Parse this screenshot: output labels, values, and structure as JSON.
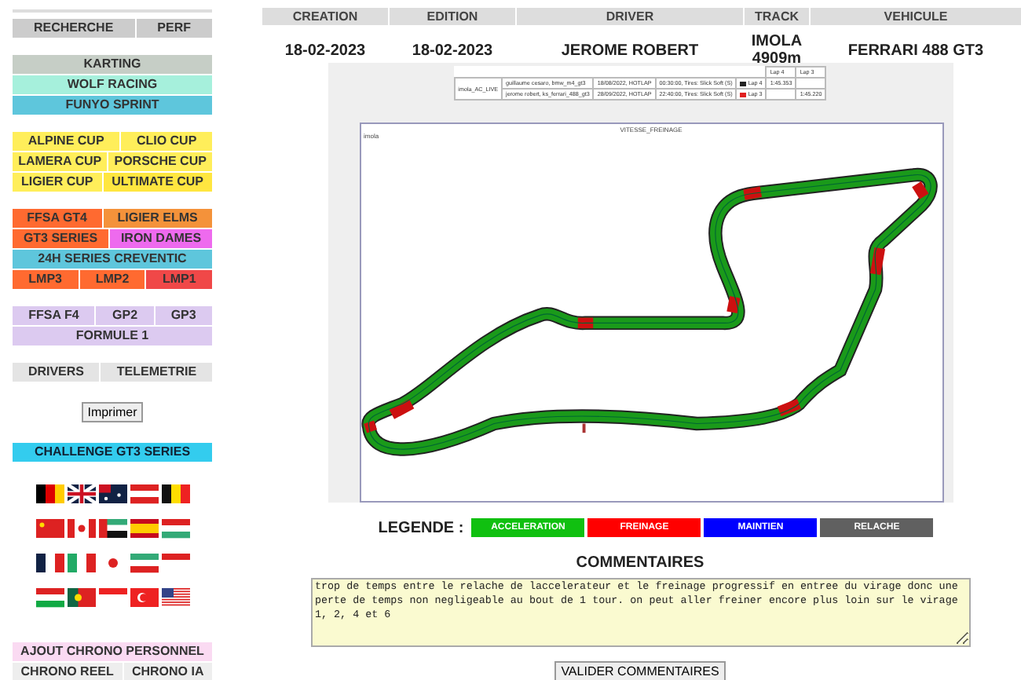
{
  "sidebar": {
    "groups": [
      [
        [
          {
            "label": "RECHERCHE",
            "color": "#cccccc"
          },
          {
            "label": "PERF",
            "color": "#cccccc"
          }
        ]
      ],
      [
        [
          {
            "label": "KARTING",
            "color": "#c6cec6"
          }
        ],
        [
          {
            "label": "WOLF RACING",
            "color": "#a6f0dc"
          }
        ],
        [
          {
            "label": "FUNYO SPRINT",
            "color": "#5ec6dc"
          }
        ]
      ],
      [
        [
          {
            "label": "ALPINE CUP",
            "color": "#ffee5a"
          },
          {
            "label": "CLIO CUP",
            "color": "#ffee5a"
          }
        ],
        [
          {
            "label": "LAMERA CUP",
            "color": "#ffee5a"
          },
          {
            "label": "PORSCHE CUP",
            "color": "#ffee5a"
          }
        ],
        [
          {
            "label": "LIGIER CUP",
            "color": "#ffee5a"
          },
          {
            "label": "ULTIMATE CUP",
            "color": "#ffe640"
          }
        ]
      ],
      [
        [
          {
            "label": "FFSA GT4",
            "color": "#ff6a30"
          },
          {
            "label": "LIGIER ELMS",
            "color": "#f4923a"
          }
        ],
        [
          {
            "label": "GT3 SERIES",
            "color": "#ff6a30"
          },
          {
            "label": "IRON DAMES",
            "color": "#ee6aee"
          }
        ],
        [
          {
            "label": "24H SERIES CREVENTIC",
            "color": "#5ec6dc"
          }
        ],
        [
          {
            "label": "LMP3",
            "color": "#ff6a30"
          },
          {
            "label": "LMP2",
            "color": "#ff6a30"
          },
          {
            "label": "LMP1",
            "color": "#f04848"
          }
        ]
      ],
      [
        [
          {
            "label": "FFSA F4",
            "color": "#dccaf0"
          },
          {
            "label": "GP2",
            "color": "#dccaf0"
          },
          {
            "label": "GP3",
            "color": "#dccaf0"
          }
        ],
        [
          {
            "label": "FORMULE 1",
            "color": "#dccaf0"
          }
        ]
      ],
      [
        [
          {
            "label": "DRIVERS",
            "color": "#e4e4e4"
          },
          {
            "label": "TELEMETRIE",
            "color": "#e4e4e4"
          }
        ]
      ]
    ],
    "print_button": "Imprimer",
    "challenge": "CHALLENGE GT3 SERIES",
    "bottom": [
      [
        {
          "label": "AJOUT CHRONO PERSONNEL",
          "color": "#fadaf2"
        }
      ],
      [
        {
          "label": "CHRONO REEL",
          "color": "#eeeeee"
        },
        {
          "label": "CHRONO IA",
          "color": "#eeeeee"
        }
      ]
    ]
  },
  "info": {
    "columns": [
      "CREATION",
      "EDITION",
      "DRIVER",
      "TRACK",
      "VEHICULE"
    ],
    "values": [
      "18-02-2023",
      "18-02-2023",
      "JEROME ROBERT",
      "IMOLA 4909m",
      "FERRARI 488 GT3"
    ]
  },
  "laps_table": {
    "track": "imola_AC_LIVE",
    "headers": [
      "Lap 4",
      "Lap 3"
    ],
    "rows": [
      {
        "driver": "guillaume cesaro, bmw_m4_gt3",
        "session": "18/08/2022, HOTLAP",
        "info": "00:30:00, Tires: Slick Soft (S)",
        "color": "#222222",
        "lap": "Lap 4",
        "time_lap_4": "1:45.353"
      },
      {
        "driver": "jerome robert, ks_ferrari_488_gt3",
        "session": "28/09/2022, HOTLAP",
        "info": "22:40:00, Tires: Slick Soft (S)",
        "color": "#e02020",
        "lap": "Lap 3",
        "time_lap_3": "1:45.220"
      }
    ]
  },
  "chart": {
    "title": "VITESSE_FREINAGE",
    "label": "imola"
  },
  "legend": {
    "label": "LEGENDE :",
    "items": [
      {
        "label": "ACCELERATION",
        "color": "#10c010"
      },
      {
        "label": "FREINAGE",
        "color": "#ff0000"
      },
      {
        "label": "MAINTIEN",
        "color": "#0000ff"
      },
      {
        "label": "RELACHE",
        "color": "#606060"
      }
    ]
  },
  "comments": {
    "title": "COMMENTAIRES",
    "value": "trop de temps entre le relache de laccelerateur et le freinage progressif en entree du virage donc une perte de temps non negligeable au bout de 1 tour. on peut aller freiner encore plus loin sur le virage 1, 2, 4 et 6",
    "button": "VALIDER COMMENTAIRES"
  }
}
